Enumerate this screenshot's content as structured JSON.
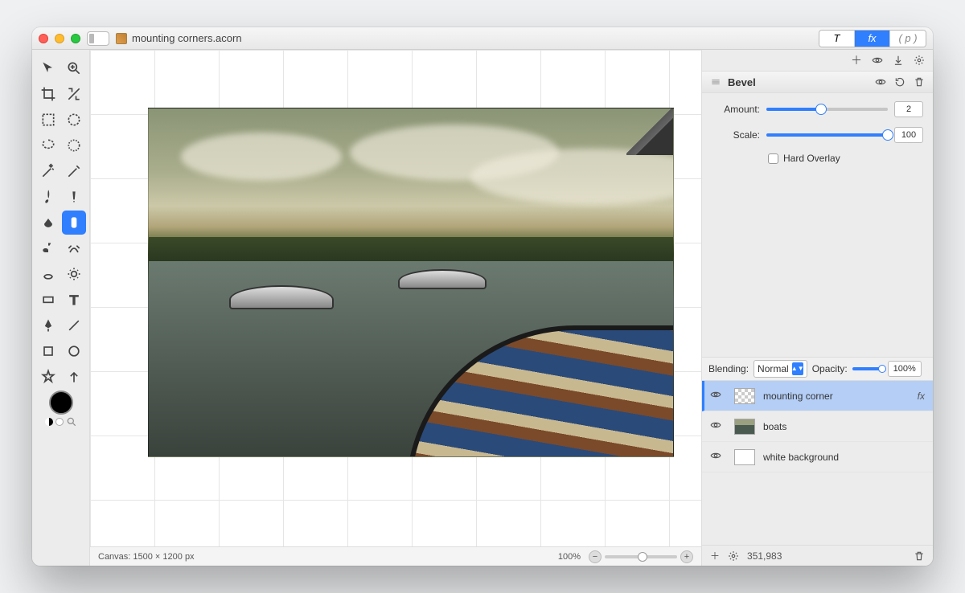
{
  "title": {
    "filename": "mounting corners.acorn"
  },
  "titlebar_tabs": {
    "t": "T",
    "fx": "fx",
    "p": "( p )"
  },
  "fx_toolbar": {},
  "filter": {
    "name": "Bevel",
    "amount_label": "Amount:",
    "amount_value": "2",
    "amount_fill_pct": 45,
    "scale_label": "Scale:",
    "scale_value": "100",
    "scale_fill_pct": 100,
    "hard_overlay_label": "Hard Overlay",
    "hard_overlay_checked": false
  },
  "blending": {
    "label": "Blending:",
    "mode": "Normal",
    "opacity_label": "Opacity:",
    "opacity_value": "100%"
  },
  "layers": [
    {
      "name": "mounting corner",
      "selected": true,
      "thumb": "checker",
      "has_fx": true
    },
    {
      "name": "boats",
      "selected": false,
      "thumb": "boats",
      "has_fx": false
    },
    {
      "name": "white background",
      "selected": false,
      "thumb": "white",
      "has_fx": false
    }
  ],
  "status": {
    "canvas": "Canvas: 1500 × 1200 px",
    "zoom": "100%",
    "memory": "351,983"
  }
}
